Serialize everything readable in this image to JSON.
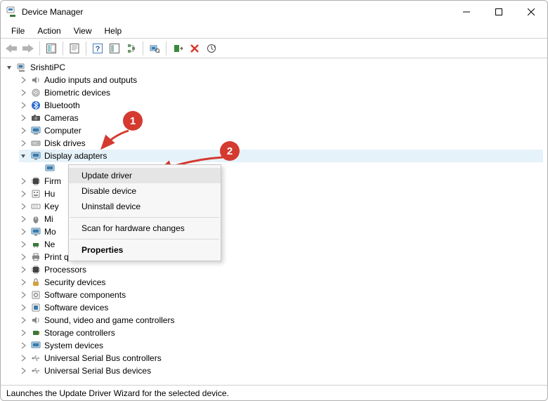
{
  "title": "Device Manager",
  "menubar": {
    "file": "File",
    "action": "Action",
    "view": "View",
    "help": "Help"
  },
  "root_label": "SrishtiPC",
  "categories": {
    "audio": "Audio inputs and outputs",
    "biometric": "Biometric devices",
    "bluetooth": "Bluetooth",
    "cameras": "Cameras",
    "computer": "Computer",
    "diskdrives": "Disk drives",
    "display": "Display adapters",
    "firmware": "Firm",
    "hid": "Hu",
    "keyboards": "Key",
    "mice": "Mi",
    "monitors": "Mo",
    "network": "Ne",
    "printqueues": "Print queues",
    "processors": "Processors",
    "security": "Security devices",
    "swcomp": "Software components",
    "swdev": "Software devices",
    "sound": "Sound, video and game controllers",
    "storage": "Storage controllers",
    "sysdev": "System devices",
    "usbctrl": "Universal Serial Bus controllers",
    "usbdev": "Universal Serial Bus devices"
  },
  "context_menu": {
    "update": "Update driver",
    "disable": "Disable device",
    "uninstall": "Uninstall device",
    "scan": "Scan for hardware changes",
    "properties": "Properties"
  },
  "statusbar": "Launches the Update Driver Wizard for the selected device.",
  "annotations": {
    "one": "1",
    "two": "2"
  }
}
